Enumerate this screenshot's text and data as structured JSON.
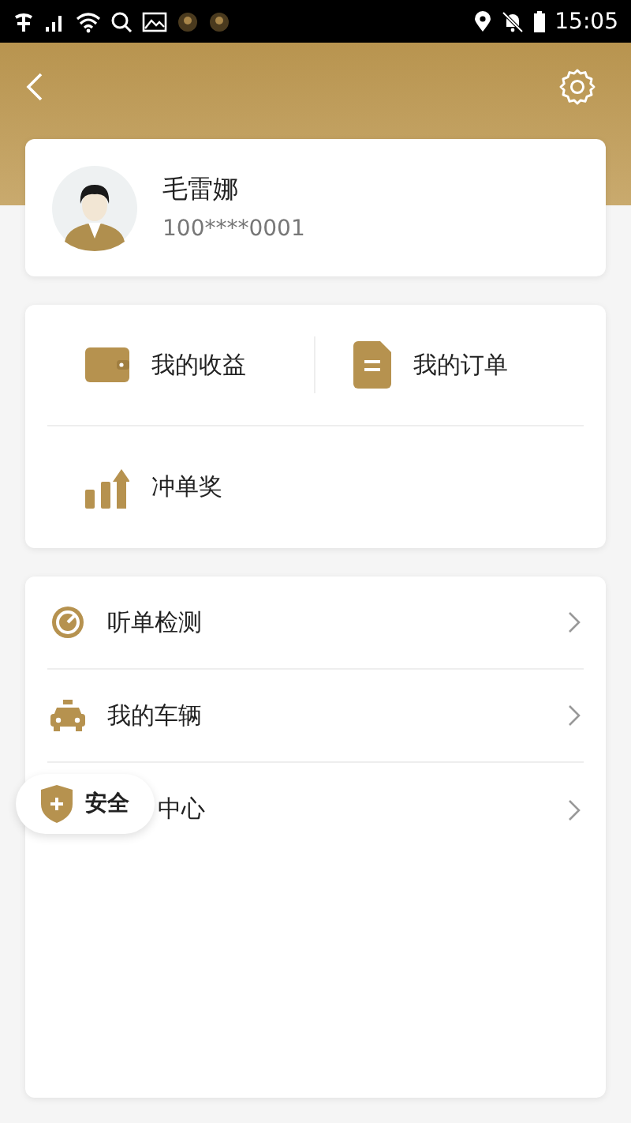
{
  "status_bar": {
    "time": "15:05"
  },
  "profile": {
    "name": "毛雷娜",
    "phone": "100****0001"
  },
  "shortcuts": [
    {
      "kind": "wallet",
      "label": "我的收益"
    },
    {
      "kind": "document",
      "label": "我的订单"
    },
    {
      "kind": "chart",
      "label": "冲单奖"
    }
  ],
  "menu": [
    {
      "kind": "gauge",
      "label": "听单检测",
      "covered": false
    },
    {
      "kind": "taxi",
      "label": "我的车辆",
      "covered": false
    },
    {
      "label": "中心",
      "covered": true
    }
  ],
  "safety_button": {
    "label": "安全"
  }
}
